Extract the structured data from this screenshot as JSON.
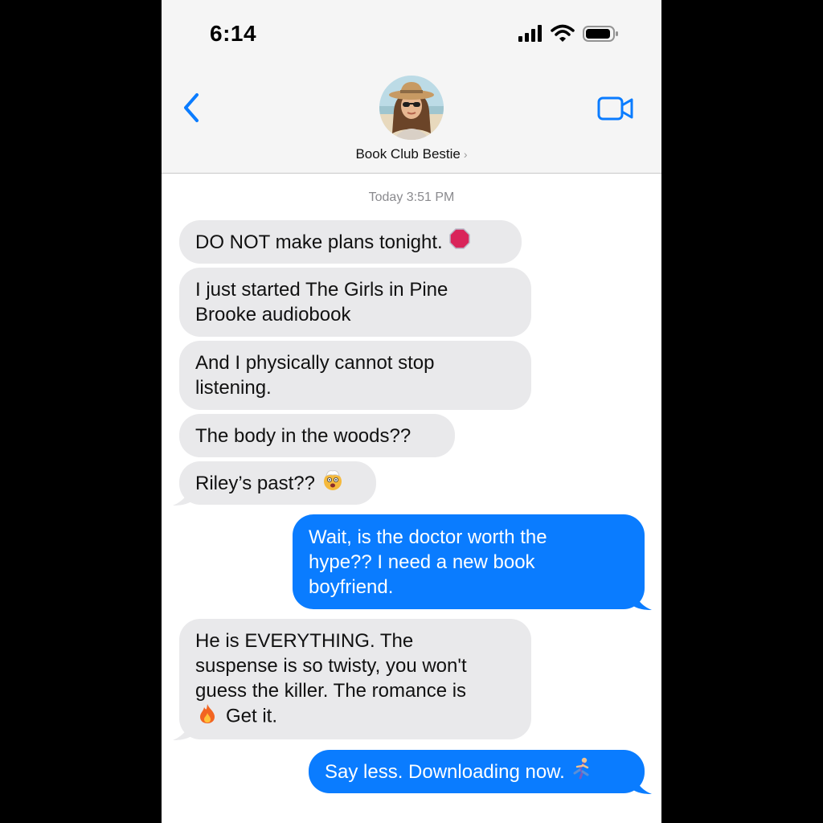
{
  "status_bar": {
    "time": "6:14"
  },
  "header": {
    "contact_name": "Book Club Bestie",
    "contact_chevron": "›"
  },
  "thread": {
    "timestamp": "Today 3:51 PM",
    "messages": [
      {
        "from": "them",
        "text": "DO NOT make plans tonight.",
        "emoji": "stop-sign-icon"
      },
      {
        "from": "them",
        "line1": "I just started The Girls in Pine",
        "line2": "Brooke audiobook"
      },
      {
        "from": "them",
        "line1": "And I physically cannot stop",
        "line2": "listening."
      },
      {
        "from": "them",
        "text": "The body in the woods??"
      },
      {
        "from": "them",
        "text": "Riley’s past??",
        "emoji": "mind-blown-emoji-icon"
      },
      {
        "from": "me",
        "line1": "Wait, is the doctor worth the",
        "line2": "hype?? I need a new book",
        "line3": "boyfriend."
      },
      {
        "from": "them",
        "line1": "He is EVERYTHING. The",
        "line2": "suspense is so twisty, you won't",
        "line3": "guess the killer. The romance is",
        "line4": "Get it.",
        "emoji": "fire-emoji-icon"
      },
      {
        "from": "me",
        "text": "Say less. Downloading now.",
        "emoji": "running-person-emoji-icon"
      }
    ]
  },
  "colors": {
    "sent_bubble": "#0a7cff",
    "received_bubble": "#e9e9eb",
    "accent": "#0a7cff"
  }
}
